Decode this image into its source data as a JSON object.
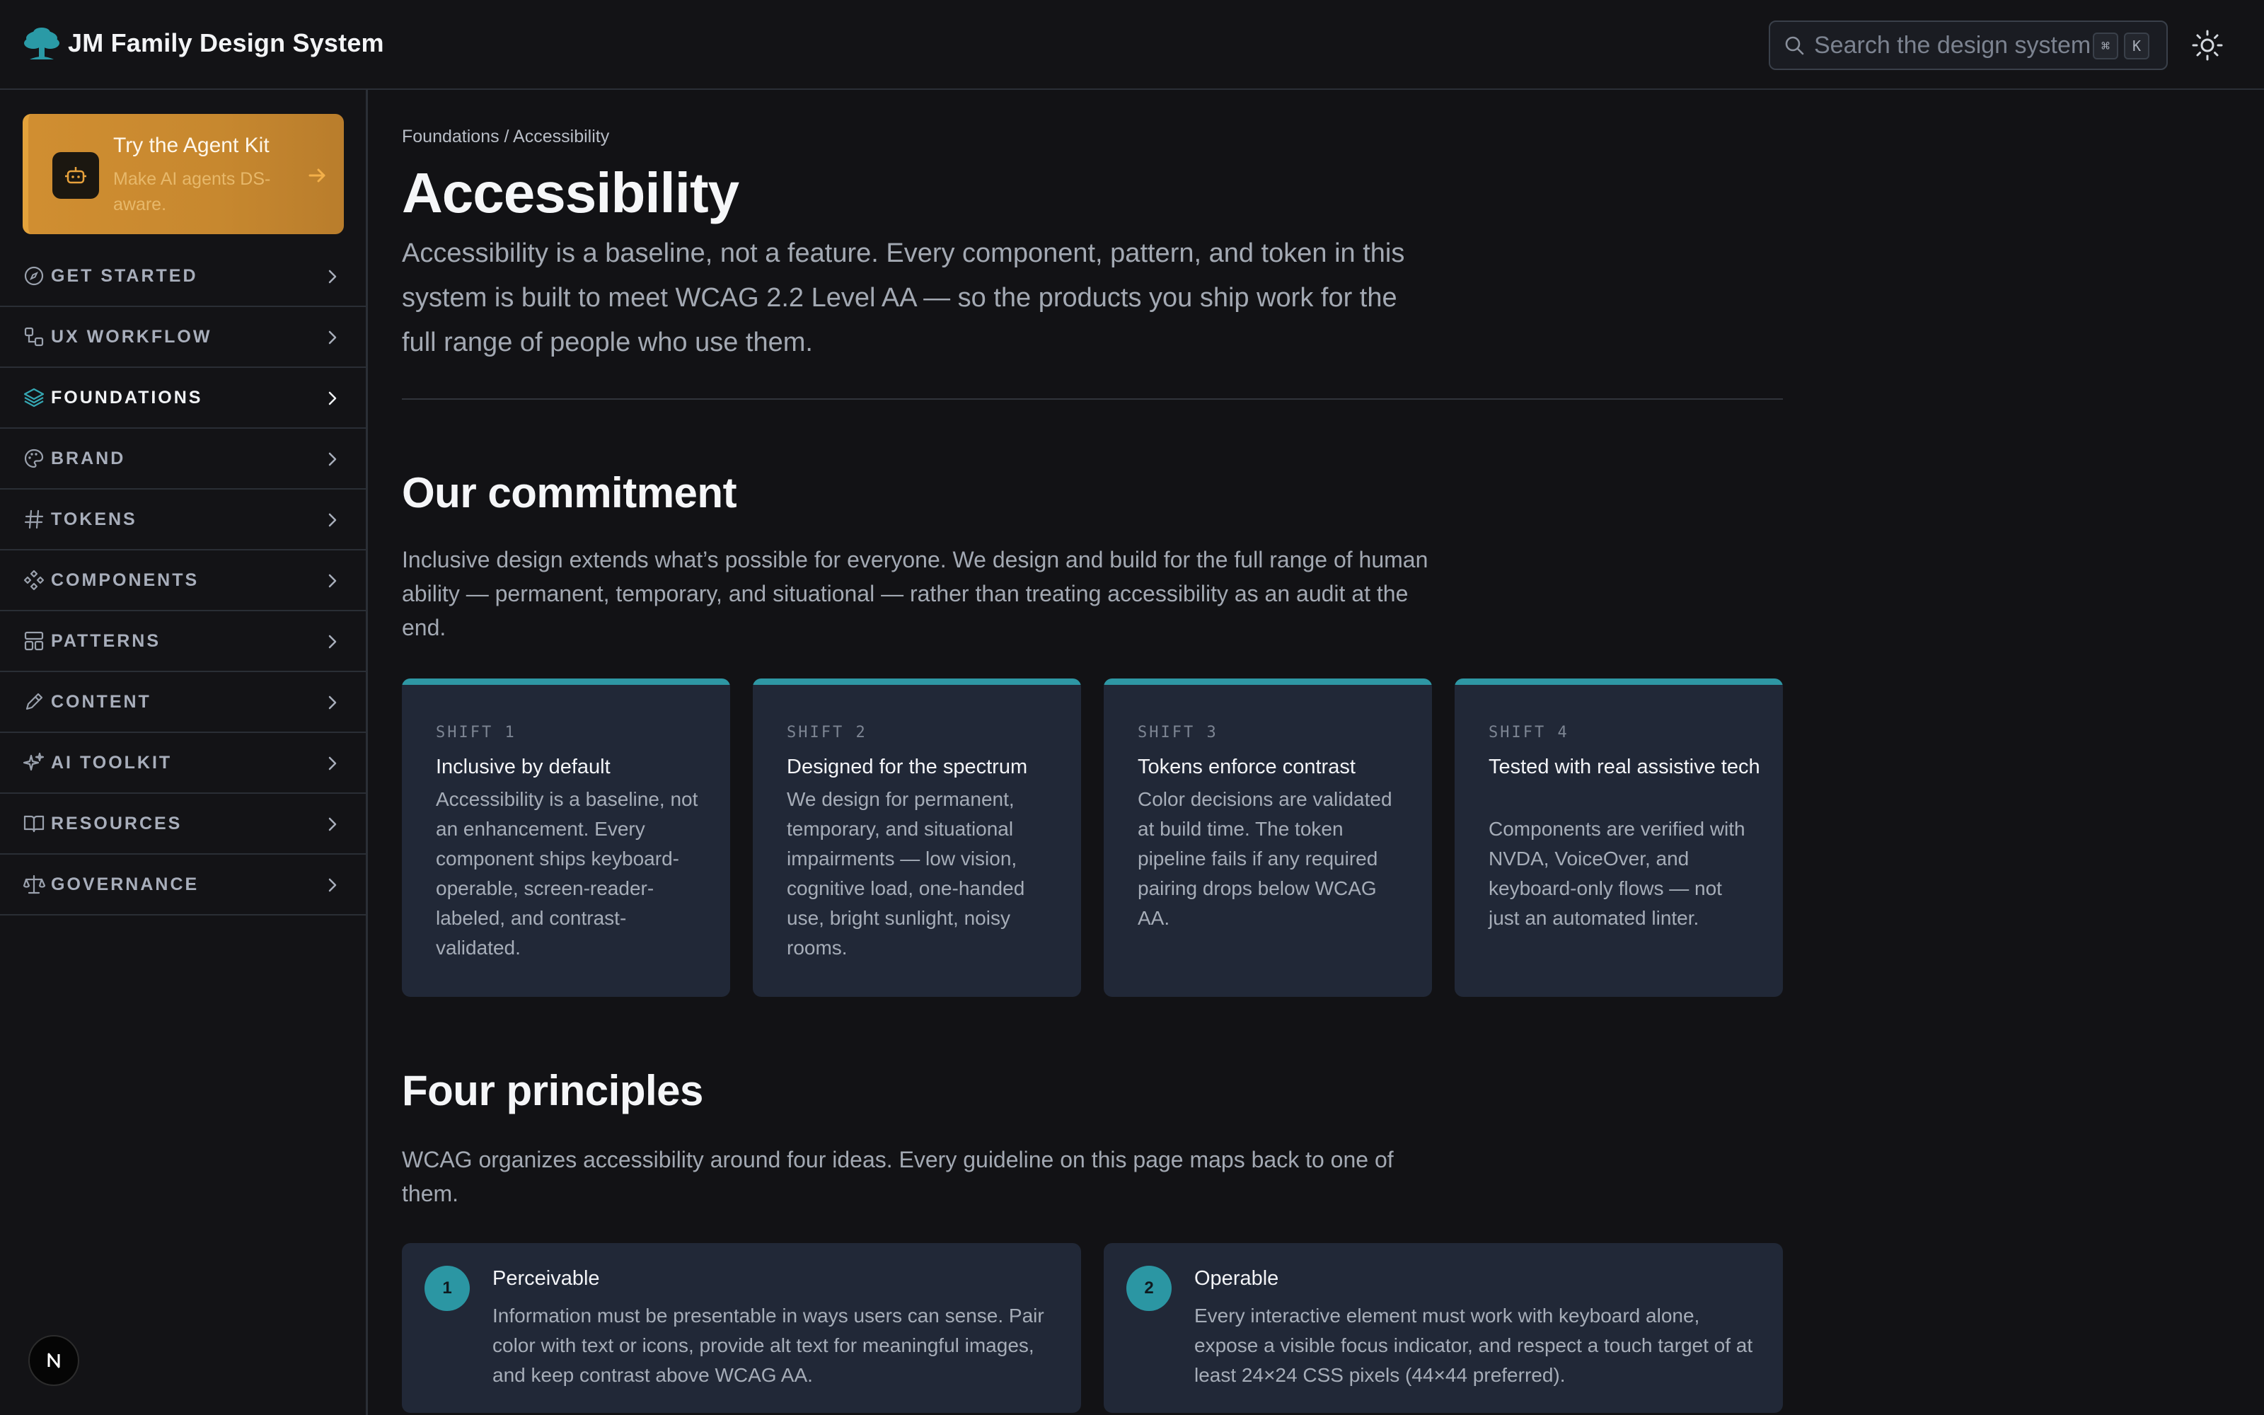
{
  "header": {
    "title": "JM Family Design System",
    "search_placeholder": "Search the design system",
    "shortcut_keys": [
      "⌘",
      "K"
    ],
    "logo_icon": "tree-icon",
    "theme_icon": "sun-icon"
  },
  "sidebar": {
    "promo": {
      "title": "Try the Agent Kit",
      "subtitle": "Make AI agents DS-aware.",
      "icon": "robot-icon",
      "accent": "#d08e31"
    },
    "items": [
      {
        "label": "GET STARTED",
        "icon": "compass-icon"
      },
      {
        "label": "UX WORKFLOW",
        "icon": "workflow-icon"
      },
      {
        "label": "FOUNDATIONS",
        "icon": "layers-icon",
        "active": true
      },
      {
        "label": "BRAND",
        "icon": "palette-icon"
      },
      {
        "label": "TOKENS",
        "icon": "hash-icon"
      },
      {
        "label": "COMPONENTS",
        "icon": "components-icon"
      },
      {
        "label": "PATTERNS",
        "icon": "layout-icon"
      },
      {
        "label": "CONTENT",
        "icon": "pen-icon"
      },
      {
        "label": "AI TOOLKIT",
        "icon": "sparkles-icon"
      },
      {
        "label": "RESOURCES",
        "icon": "book-icon"
      },
      {
        "label": "GOVERNANCE",
        "icon": "scale-icon"
      }
    ]
  },
  "main": {
    "breadcrumb": "Foundations / Accessibility",
    "title": "Accessibility",
    "lead": "Accessibility is a baseline, not a feature. Every component, pattern, and token in this system is built to meet WCAG 2.2 Level AA — so the products you ship work for the full range of people who use them.",
    "commitment": {
      "heading": "Our commitment",
      "text": "Inclusive design extends what’s possible for everyone. We design and build for the full range of human ability — permanent, temporary, and situational — rather than treating accessibility as an audit at the end.",
      "shifts": [
        {
          "kicker": "SHIFT 1",
          "title": "Inclusive by default",
          "body": "Accessibility is a baseline, not an enhancement. Every component ships keyboard-operable, screen-reader-labeled, and contrast-validated."
        },
        {
          "kicker": "SHIFT 2",
          "title": "Designed for the spectrum",
          "body": "We design for permanent, temporary, and situational impairments — low vision, cognitive load, one-handed use, bright sunlight, noisy rooms."
        },
        {
          "kicker": "SHIFT 3",
          "title": "Tokens enforce contrast",
          "body": "Color decisions are validated at build time. The token pipeline fails if any required pairing drops below WCAG AA."
        },
        {
          "kicker": "SHIFT 4",
          "title": "Tested with real assistive tech",
          "body": "Components are verified with NVDA, VoiceOver, and keyboard-only flows — not just an automated linter."
        }
      ]
    },
    "principles": {
      "heading": "Four principles",
      "text": "WCAG organizes accessibility around four ideas. Every guideline on this page maps back to one of them.",
      "items": [
        {
          "num": "1",
          "title": "Perceivable",
          "body": "Information must be presentable in ways users can sense. Pair color with text or icons, provide alt text for meaningful images, and keep contrast above WCAG AA."
        },
        {
          "num": "2",
          "title": "Operable",
          "body": "Every interactive element must work with keyboard alone, expose a visible focus indicator, and respect a touch target of at least 24×24 CSS pixels (44×44 preferred)."
        }
      ]
    }
  },
  "colors": {
    "background": "#121215",
    "card": "#212837",
    "teal_accent": "#2e97a4",
    "promo_orange": "#d08e31"
  }
}
